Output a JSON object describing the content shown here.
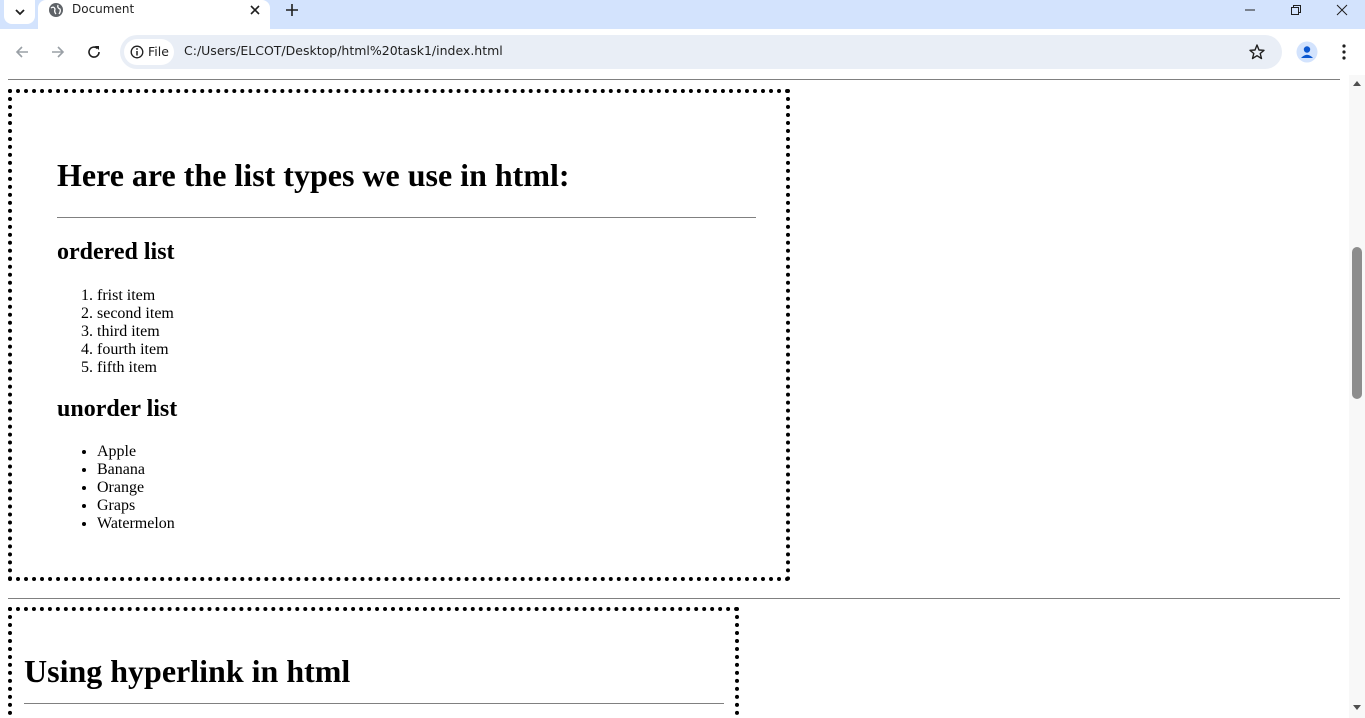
{
  "browser": {
    "tab": {
      "title": "Document",
      "favicon": "globe-icon"
    },
    "omnibox": {
      "site_chip_label": "File",
      "url": "C:/Users/ELCOT/Desktop/html%20task1/index.html"
    },
    "icons": [
      "chevron-down-icon",
      "close-icon",
      "plus-icon",
      "minimize-icon",
      "restore-icon",
      "back-icon",
      "forward-icon",
      "reload-icon",
      "info-icon",
      "star-icon",
      "profile-icon",
      "kebab-menu-icon"
    ]
  },
  "page": {
    "lists_section": {
      "heading": "Here are the list types we use in html:",
      "ordered_heading": "ordered list",
      "ordered_items": [
        "frist item",
        "second item",
        "third item",
        "fourth item",
        "fifth item"
      ],
      "unordered_heading": "unorder list",
      "unordered_items": [
        "Apple",
        "Banana",
        "Orange",
        "Graps",
        "Watermelon"
      ]
    },
    "links_section": {
      "heading": "Using hyperlink in html"
    }
  },
  "scrollbar": {
    "position_fraction": 0.27
  },
  "colors": {
    "tabstrip": "#d3e3fd",
    "omnibox": "#e9eef6",
    "border": "#000000",
    "rule": "#808080"
  }
}
